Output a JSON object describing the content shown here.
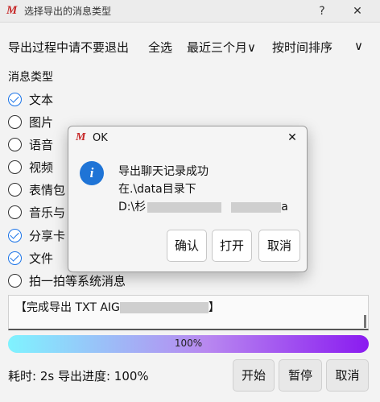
{
  "window": {
    "logo": "M",
    "title": "选择导出的消息类型",
    "help": "?",
    "close": "✕"
  },
  "toolbar": {
    "notice": "导出过程中请不要退出",
    "select_all": "全选",
    "range": "近三个月",
    "range_prefix": "最",
    "range_chevron": "∨",
    "sort": "按时间排序",
    "sort_chevron": "∨"
  },
  "message_types": {
    "label": "消息类型",
    "options": [
      {
        "label": "文本",
        "checked": true
      },
      {
        "label": "图片",
        "checked": false
      },
      {
        "label": "语音",
        "checked": false
      },
      {
        "label": "视频",
        "checked": false
      },
      {
        "label": "表情包",
        "checked": false
      },
      {
        "label": "音乐与",
        "checked": false
      },
      {
        "label": "分享卡",
        "checked": true
      },
      {
        "label": "文件",
        "checked": true
      },
      {
        "label": "拍一拍等系统消息",
        "checked": false
      }
    ]
  },
  "log": {
    "prefix": "【完成导出 TXT AIG",
    "suffix": "】"
  },
  "progress": {
    "percent": 100,
    "label": "100%"
  },
  "status": {
    "text": "耗时: 2s  导出进度: 100%"
  },
  "buttons": {
    "start": "开始",
    "pause": "暂停",
    "cancel": "取消"
  },
  "dialog": {
    "logo": "M",
    "title": "OK",
    "close": "✕",
    "icon": "i",
    "line1": "导出聊天记录成功",
    "line2": "在.\\data目录下",
    "line3_prefix": "D:\\杉",
    "line3_suffix": "a",
    "confirm": "确认",
    "open": "打开",
    "cancel": "取消"
  },
  "colors": {
    "accent": "#1a73e8",
    "info_icon": "#1f74d6",
    "progress_start": "#7ff3ff",
    "progress_end": "#8a1bf0",
    "logo": "#c62828"
  }
}
